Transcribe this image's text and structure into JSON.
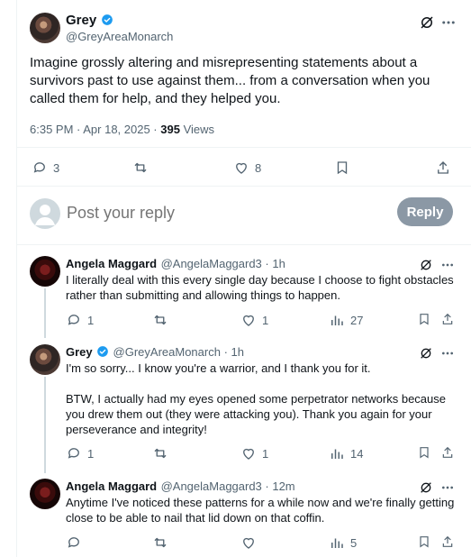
{
  "main_tweet": {
    "name": "Grey",
    "handle": "@GreyAreaMonarch",
    "text_lines": [
      "Imagine grossly altering and misrepresenting statements about a",
      "survivors past to use against them... from a conversation when you",
      "called them for help, and they helped you."
    ],
    "time": "6:35 PM · Apr 18, 2025 ·",
    "views_count": "395",
    "views_label": "Views",
    "replies": "3",
    "likes": "8"
  },
  "composer": {
    "placeholder": "Post your reply",
    "reply_label": "Reply"
  },
  "replies": [
    {
      "name": "Angela Maggard",
      "handle": "@AngelaMaggard3 · 1h",
      "lines": [
        "I literally deal with this every single day because I choose to fight obstacles",
        "rather than submitting and allowing things to happen."
      ],
      "replies": "1",
      "likes": "1",
      "views": "27"
    },
    {
      "name": "Grey",
      "handle": "@GreyAreaMonarch · 1h",
      "lines": [
        "I'm so sorry... I know you're a warrior, and I thank you for it.",
        "",
        "BTW, I actually had my eyes opened some perpetrator networks because",
        "you drew them out (they were attacking you). Thank you again for your",
        "perseverance and integrity!"
      ],
      "replies": "1",
      "likes": "1",
      "views": "14"
    },
    {
      "name": "Angela Maggard",
      "handle": "@AngelaMaggard3 · 12m",
      "lines": [
        "Anytime I've noticed these patterns for a while now and we're finally getting",
        "close to be able to nail that lid down on that coffin."
      ],
      "replies": "",
      "likes": "",
      "views": "5"
    }
  ],
  "colors": {
    "verified": "#1d9bf0",
    "muted": "#536471",
    "reply_button": "#8b98a5"
  }
}
